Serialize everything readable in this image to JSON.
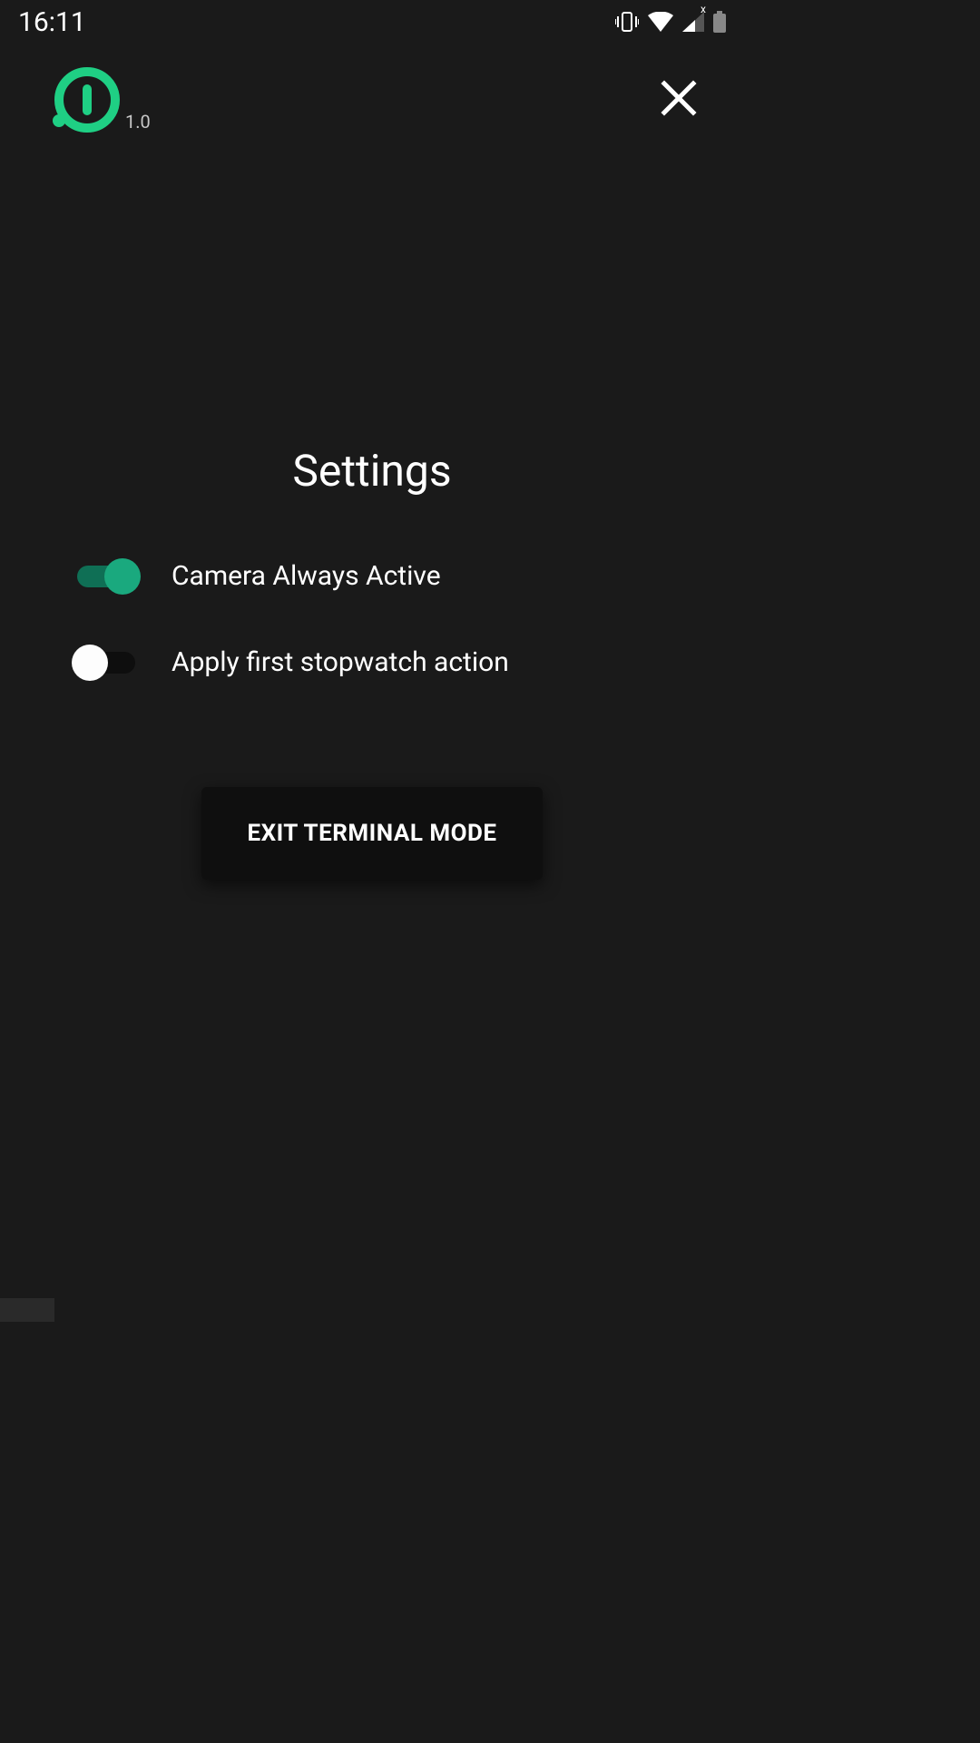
{
  "status": {
    "time": "16:11",
    "signal_x": "x"
  },
  "header": {
    "version": "1.0"
  },
  "page": {
    "title": "Settings"
  },
  "settings": {
    "camera": {
      "label": "Camera Always Active",
      "on": true
    },
    "stopwatch": {
      "label": "Apply first stopwatch action",
      "on": false
    }
  },
  "actions": {
    "exit": "EXIT TERMINAL MODE"
  }
}
